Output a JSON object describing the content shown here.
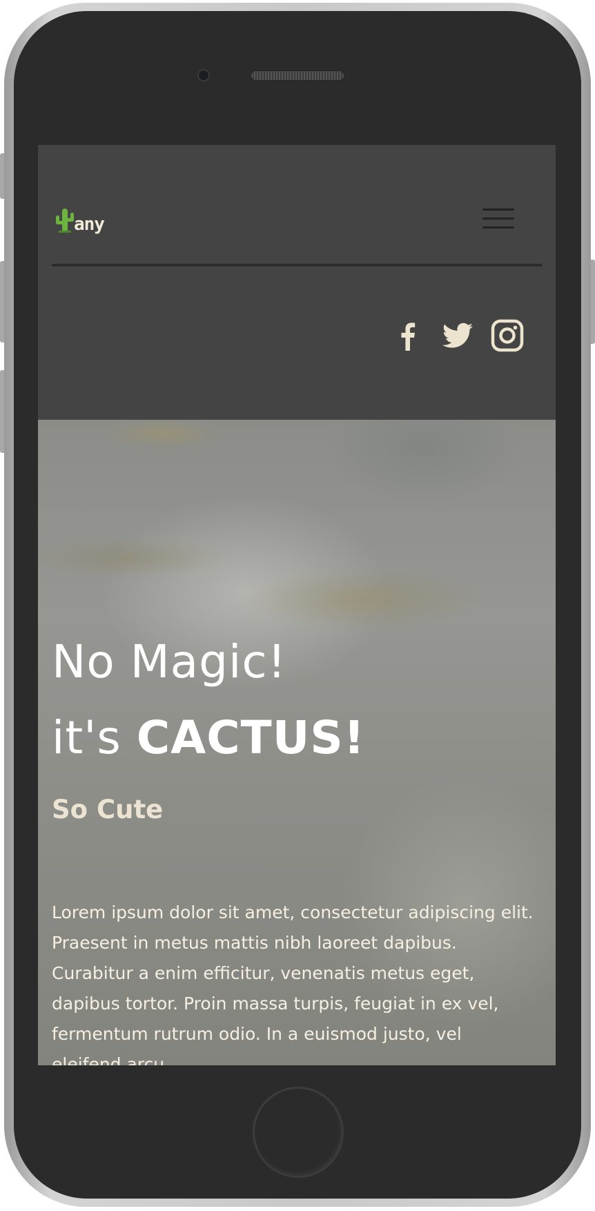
{
  "brand": {
    "logo_text": "any",
    "logo_icon": "cactus-icon"
  },
  "header": {
    "menu_icon": "hamburger-menu-icon",
    "social": [
      {
        "name": "facebook",
        "icon": "facebook-icon"
      },
      {
        "name": "twitter",
        "icon": "twitter-icon"
      },
      {
        "name": "instagram",
        "icon": "instagram-icon"
      }
    ]
  },
  "hero": {
    "title_line1": "No Magic!",
    "title_line2_prefix": "it's ",
    "title_line2_bold": "CACTUS!",
    "subtitle": "So Cute",
    "body": "Lorem ipsum dolor sit amet, consectetur adipiscing elit. Praesent in metus mattis nibh laoreet dapibus. Curabitur a enim efficitur, venenatis metus eget, dapibus tortor. Proin massa turpis, feugiat in ex vel, fermentum rutrum odio. In a euismod justo, vel eleifend arcu."
  },
  "colors": {
    "header_bg": "#444444",
    "divider": "#2c2c2c",
    "social_icon": "#ede4d0",
    "cactus_green": "#6cb33f",
    "subtitle": "#ece3d3",
    "hero_text": "#f6efe2",
    "phone_body": "#2b2b2b"
  }
}
